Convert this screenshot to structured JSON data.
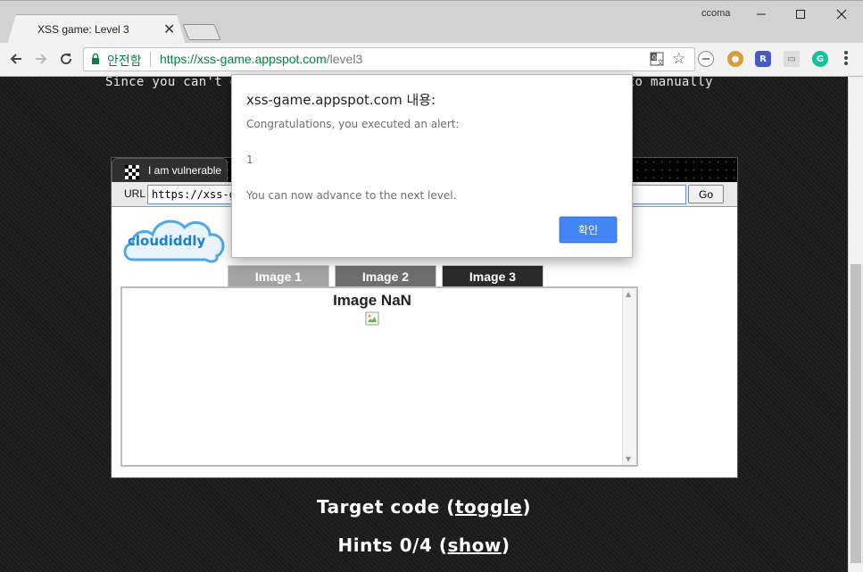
{
  "window": {
    "user": "ccoma",
    "tab_title": "XSS game: Level 3"
  },
  "toolbar": {
    "secure_label": "안전함",
    "url_host": "https://xss-game.appspot.com",
    "url_path": "/level3"
  },
  "page": {
    "intro_text": "Since you can't en                                            have to manually",
    "frame": {
      "tab_label": "I am vulnerable",
      "url_label": "URL",
      "url_value": "https://xss-ga",
      "go_label": "Go"
    },
    "logo_text": "cloudiddly",
    "image_tabs": [
      "Image 1",
      "Image 2",
      "Image 3"
    ],
    "image_title": "Image NaN",
    "target_code": {
      "prefix": "Target code (",
      "link": "toggle",
      "suffix": ")"
    },
    "hints": {
      "prefix": "Hints 0/4 (",
      "link": "show",
      "suffix": ")"
    }
  },
  "dialog": {
    "title": "xss-game.appspot.com 내용:",
    "line1": "Congratulations, you executed an alert:",
    "line2": "1",
    "line3": "You can now advance to the next level.",
    "ok_label": "확인"
  },
  "colors": {
    "secure_green": "#0b8043",
    "ok_button": "#4285f4"
  }
}
